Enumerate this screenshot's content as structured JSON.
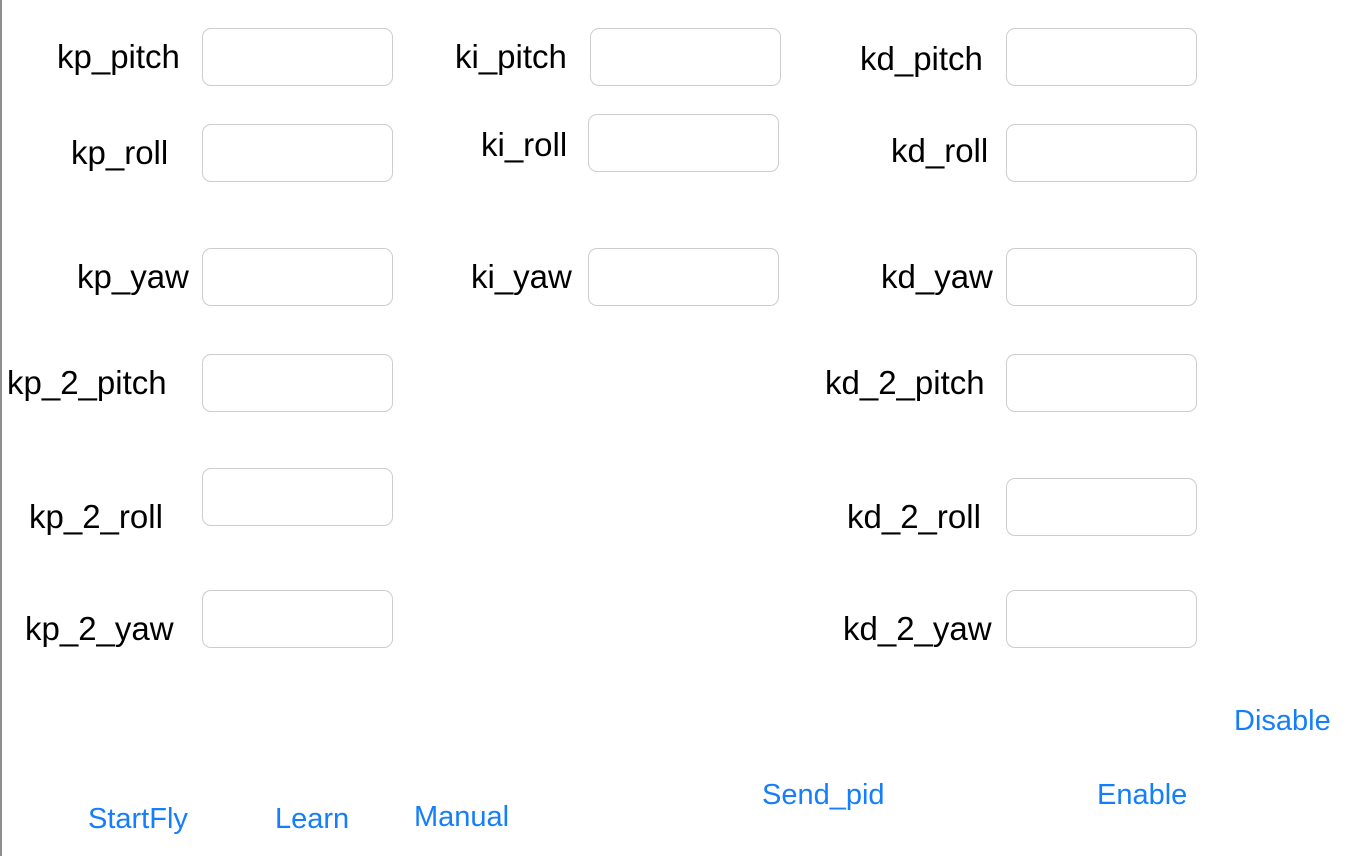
{
  "theme": {
    "accent": "#147efb",
    "label_color": "#000000",
    "field_border": "#cdcdcd"
  },
  "labels": {
    "kp_pitch": "kp_pitch",
    "ki_pitch": "ki_pitch",
    "kd_pitch": "kd_pitch",
    "kp_roll": "kp_roll",
    "ki_roll": "ki_roll",
    "kd_roll": "kd_roll",
    "kp_yaw": "kp_yaw",
    "ki_yaw": "ki_yaw",
    "kd_yaw": "kd_yaw",
    "kp_2_pitch": "kp_2_pitch",
    "kd_2_pitch": "kd_2_pitch",
    "kp_2_roll": "kp_2_roll",
    "kd_2_roll": "kd_2_roll",
    "kp_2_yaw": "kp_2_yaw",
    "kd_2_yaw": "kd_2_yaw"
  },
  "fields": {
    "kp_pitch": "",
    "ki_pitch": "",
    "kd_pitch": "",
    "kp_roll": "",
    "ki_roll": "",
    "kd_roll": "",
    "kp_yaw": "",
    "ki_yaw": "",
    "kd_yaw": "",
    "kp_2_pitch": "",
    "kd_2_pitch": "",
    "kp_2_roll": "",
    "kd_2_roll": "",
    "kp_2_yaw": "",
    "kd_2_yaw": ""
  },
  "buttons": {
    "disable": "Disable",
    "startfly": "StartFly",
    "learn": "Learn",
    "manual": "Manual",
    "send_pid": "Send_pid",
    "enable": "Enable"
  }
}
